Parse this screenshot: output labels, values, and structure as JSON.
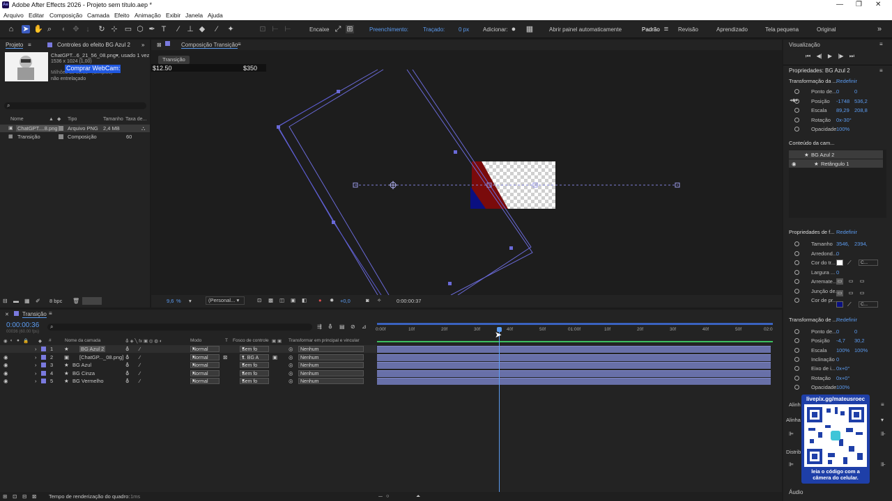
{
  "titlebar": {
    "app_icon": "Ae",
    "title": "Adobe After Effects 2026 - Projeto sem título.aep *"
  },
  "menu": [
    "Arquivo",
    "Editar",
    "Composição",
    "Camada",
    "Efeito",
    "Animação",
    "Exibir",
    "Janela",
    "Ajuda"
  ],
  "toolbar": {
    "encaixe": "Encaixe",
    "preenchimento": "Preenchimento:",
    "tracado": "Traçado:",
    "tracado_px": "0 px",
    "adicionar": "Adicionar:",
    "abrir_painel": "Abrir painel automaticamente",
    "workspaces": [
      "Padrão",
      "Revisão",
      "Aprendizado",
      "Tela pequena",
      "Original"
    ],
    "fill_color": "#0a1080"
  },
  "project": {
    "tab_project": "Projeto",
    "tab_effects": "Controles do efeito BG Azul 2",
    "file_name": "ChatGPT...6_21_56_08.png",
    "used": ", usado 1 vez",
    "dims": "1536 x 1024 (1,00)",
    "colors": "Milhões de cores+ (Simples)",
    "interlace": "não entrelaçado",
    "overlay": "Comprar WebCam:",
    "columns": [
      "Nome",
      "Tipo",
      "Tamanho",
      "Taxa de..."
    ],
    "items": [
      {
        "name": "ChatGPT....8.png",
        "type": "Arquivo PNG",
        "size": "2,4 MB",
        "rate": ""
      },
      {
        "name": "Transição",
        "type": "Composição",
        "size": "",
        "rate": "60"
      }
    ],
    "bpc": "8 bpc"
  },
  "comp": {
    "tab": "Composição Transição",
    "subtab": "Transição",
    "price_left": "$12.50",
    "price_right": "$350",
    "zoom": "9,6",
    "zoom_unit": "%",
    "view": "(Personal...",
    "exposure": "+0,0",
    "timecode": "0:00:00:37"
  },
  "timeline": {
    "tab": "Transição",
    "timecode": "0:00:00:36",
    "fps": "00036 (60.00 fps)",
    "headers": [
      "#",
      "Nome da camada",
      "Modo",
      "T",
      "Fosco de controle",
      "Transformar em principal e vincular"
    ],
    "ruler": [
      "0:00f",
      "10f",
      "20f",
      "30f",
      "40f",
      "50f",
      "01:00f",
      "10f",
      "20f",
      "30f",
      "40f",
      "50f",
      "02:0"
    ],
    "layers": [
      {
        "num": "1",
        "name": "BG Azul 2",
        "mode": "Normal",
        "matte": "Sem fo",
        "parent": "Nenhum",
        "color": "#7a7adf"
      },
      {
        "num": "2",
        "name": "[ChatGP..._08.png]",
        "mode": "Normal",
        "matte": "1. BG A",
        "parent": "Nenhum",
        "color": "#7a7adf"
      },
      {
        "num": "3",
        "name": "BG Azul",
        "mode": "Normal",
        "matte": "Sem fo",
        "parent": "Nenhum",
        "color": "#7a7adf"
      },
      {
        "num": "4",
        "name": "BG Cinza",
        "mode": "Normal",
        "matte": "Sem fo",
        "parent": "Nenhum",
        "color": "#7a7adf"
      },
      {
        "num": "5",
        "name": "BG Vermelho",
        "mode": "Normal",
        "matte": "Sem fo",
        "parent": "Nenhum",
        "color": "#7a7adf"
      }
    ],
    "playhead_fraction": 0.31
  },
  "status": {
    "render_time": "Tempo de renderização do quadro:",
    "render_value": "1ms"
  },
  "right": {
    "visualizacao": "Visualização",
    "props_title": "Propriedades: BG Azul 2",
    "transform": "Transformação da ...",
    "redefinir": "Redefinir",
    "transform_props": [
      {
        "label": "Ponto de...",
        "v1": "0",
        "v2": "0"
      },
      {
        "label": "Posição",
        "v1": "-1748",
        "v2": "536,2"
      },
      {
        "label": "Escala",
        "v1": "89,29",
        "v2": "208,8"
      },
      {
        "label": "Rotação",
        "v1": "0x-30°",
        "v2": ""
      },
      {
        "label": "Opacidade",
        "v1": "100%",
        "v2": ""
      }
    ],
    "content_title": "Conteúdo da cam...",
    "content_items": [
      "BG Azul 2",
      "Retângulo 1"
    ],
    "shape_title": "Propriedades de f...",
    "shape_props": [
      {
        "label": "Tamanho",
        "v1": "3546,",
        "v2": "2394,"
      },
      {
        "label": "Arredond...",
        "v1": "0",
        "v2": ""
      },
      {
        "label": "Cor do tr...",
        "v1": "",
        "v2": ""
      },
      {
        "label": "Largura ...",
        "v1": "0",
        "v2": ""
      },
      {
        "label": "Arremate...",
        "v1": "",
        "v2": ""
      },
      {
        "label": "Junção de...",
        "v1": "",
        "v2": ""
      },
      {
        "label": "Cor de pr...",
        "v1": "",
        "v2": ""
      }
    ],
    "transform2_title": "Transformação de ...",
    "transform2_props": [
      {
        "label": "Ponto de...",
        "v1": "0",
        "v2": "0"
      },
      {
        "label": "Posição",
        "v1": "-4,7",
        "v2": "30,2"
      },
      {
        "label": "Escala",
        "v1": "100%",
        "v2": "100%"
      },
      {
        "label": "Inclinação",
        "v1": "0",
        "v2": ""
      },
      {
        "label": "Eixo de i...",
        "v1": "0x+0°",
        "v2": ""
      },
      {
        "label": "Rotação",
        "v1": "0x+0°",
        "v2": ""
      },
      {
        "label": "Opacidade",
        "v1": "100%",
        "v2": ""
      }
    ],
    "align_label": "Alinh",
    "align_label2": "Alinha",
    "distrib_label": "Distrib",
    "audio": "Áudio",
    "cor_label": "C..."
  },
  "qr": {
    "url": "livepix.gg/mateusroec",
    "caption": "leia o código com a câmera do celular."
  }
}
